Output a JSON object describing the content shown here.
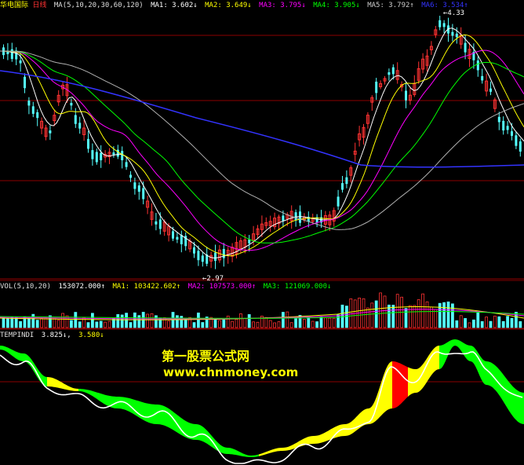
{
  "colors": {
    "up": "#ff3232",
    "down": "#54ffff",
    "grid": "#8b0000",
    "ma5": "#ffffff",
    "ma10": "#ffff00",
    "ma20": "#ff00ff",
    "ma30": "#00ff00",
    "ma60": "#b0b0b0",
    "ma120": "#3333ff",
    "fill_green": "#00ff00",
    "fill_yellow": "#ffff00",
    "fill_red": "#ff0000"
  },
  "main_header": {
    "title": "华电国际",
    "period": "日线",
    "ma": "MA(5,10,20,30,60,120)",
    "ma1": "MA1: 3.602↓",
    "ma2": "MA2: 3.649↓",
    "ma3": "MA3: 3.795↓",
    "ma4": "MA4: 3.905↓",
    "ma5": "MA5: 3.792↑",
    "ma6": "MA6: 3.534↑"
  },
  "annotations": {
    "high": "4.33",
    "low": "2.97"
  },
  "vol_header": {
    "name": "VOL(5,10,20)",
    "value": "153072.000↑",
    "ma1": "MA1: 103422.602↑",
    "ma2": "MA2: 107573.000↑",
    "ma3": "MA3: 121069.000↓"
  },
  "ind_header": {
    "name": "TEMPINDI",
    "v1": "3.825↓,",
    "v2": "3.580↓"
  },
  "watermark": {
    "line1": "第一股票公式网",
    "line2": "www.chnmoney.com"
  }
}
